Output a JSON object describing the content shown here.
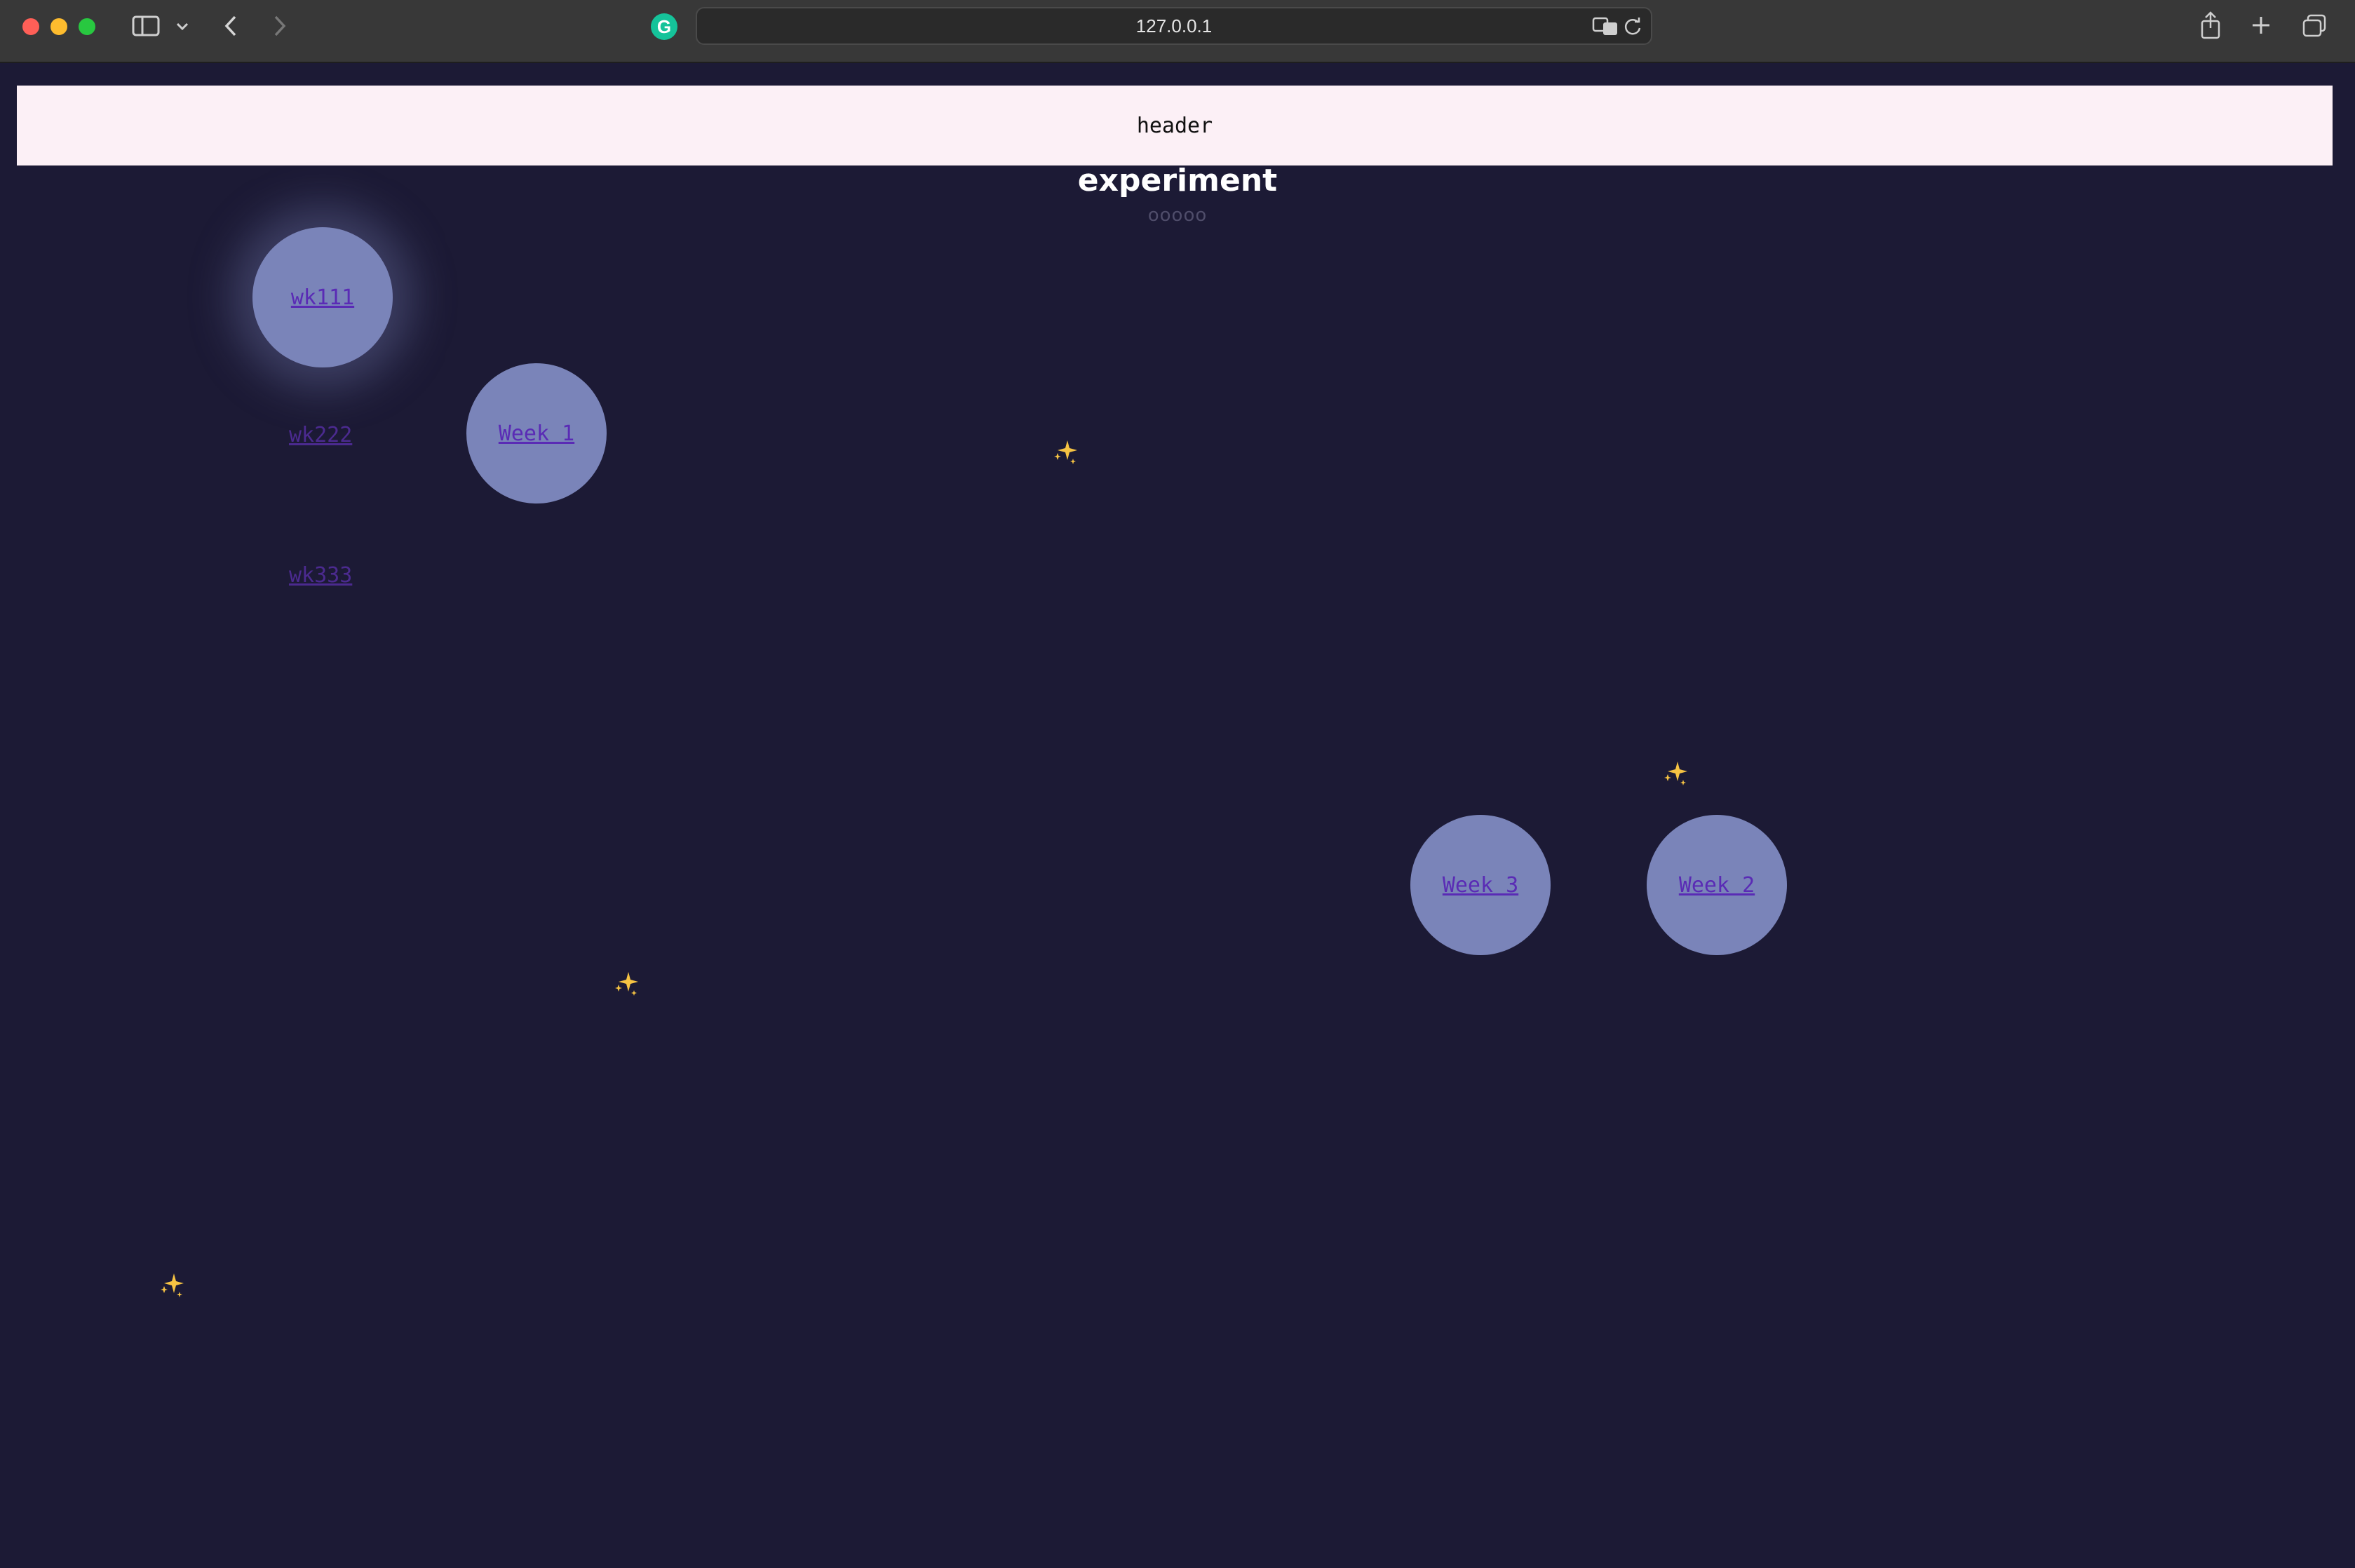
{
  "browser": {
    "url": "127.0.0.1",
    "colors": {
      "close": "#ff5f57",
      "minimize": "#febc2e",
      "maximize": "#28c840"
    }
  },
  "page": {
    "header_text": "header",
    "title": "experiment",
    "subtitle": "ooooo",
    "background_color": "#1c1a35",
    "bubble_color": "#7a84b9",
    "links": {
      "wk111": "wk111",
      "wk222": "wk222",
      "wk333": "wk333",
      "week1": "Week 1",
      "week2": "Week 2",
      "week3": "Week 3"
    },
    "decorations": [
      "sparkles-icon",
      "sparkles-icon",
      "sparkles-icon",
      "sparkles-icon"
    ]
  }
}
